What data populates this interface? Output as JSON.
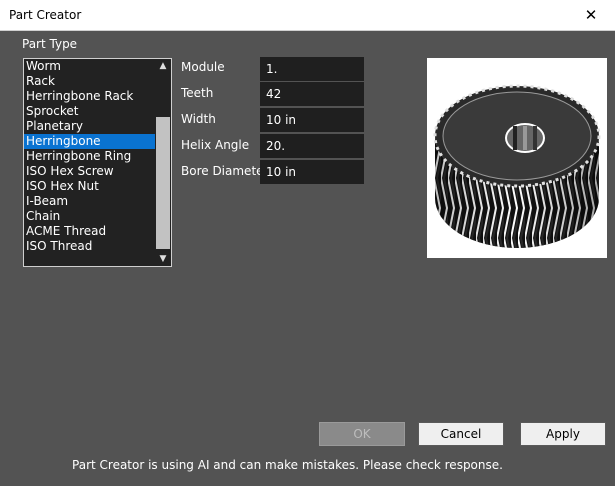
{
  "window": {
    "title": "Part Creator",
    "close_glyph": "✕"
  },
  "part_type": {
    "label": "Part Type",
    "items": [
      "Worm",
      "Rack",
      "Herringbone Rack",
      "Sprocket",
      "Planetary",
      "Herringbone",
      "Herringbone Ring",
      "ISO Hex Screw",
      "ISO Hex Nut",
      "I-Beam",
      "Chain",
      "ACME Thread",
      "ISO Thread"
    ],
    "selected": "Herringbone"
  },
  "fields": {
    "module": {
      "label": "Module",
      "value": "1."
    },
    "teeth": {
      "label": "Teeth",
      "value": "42"
    },
    "width": {
      "label": "Width",
      "value": "10 in"
    },
    "helix_angle": {
      "label": "Helix Angle",
      "value": "20."
    },
    "bore_diameter": {
      "label": "Bore Diameter",
      "value": "10 in"
    }
  },
  "preview": {
    "icon": "herringbone-gear"
  },
  "buttons": {
    "ok": "OK",
    "cancel": "Cancel",
    "apply": "Apply"
  },
  "disclaimer": "Part Creator is using AI and can make mistakes. Please check response."
}
